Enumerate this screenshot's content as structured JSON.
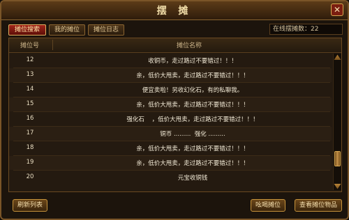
{
  "window": {
    "title": "摆 摊",
    "close_icon": "close-icon"
  },
  "tabs": [
    {
      "label": "摊位搜索",
      "active": true
    },
    {
      "label": "我的摊位",
      "active": false
    },
    {
      "label": "摊位日志",
      "active": false
    }
  ],
  "online": {
    "label": "在线摆摊数：22"
  },
  "table": {
    "headers": {
      "number": "摊位号",
      "name": "摊位名称"
    },
    "rows": [
      {
        "number": "12",
        "name": "收铜币，走过路过不要错过！！！"
      },
      {
        "number": "13",
        "name": "亲，低价大甩卖，走过路过不要错过！！！"
      },
      {
        "number": "14",
        "name": "便宜卖啦！另收幻化石，有的私聊我。"
      },
      {
        "number": "15",
        "name": "亲，低价大甩卖，走过路过不要错过！！！"
      },
      {
        "number": "16",
        "name": "强化石    ，低价大甩卖，走过路过不要错过！！！"
      },
      {
        "number": "17",
        "name": "铜币 .........  强化 ........."
      },
      {
        "number": "18",
        "name": "亲，低价大甩卖，走过路过不要错过！！！"
      },
      {
        "number": "19",
        "name": "亲，低价大甩卖，走过路过不要错过！！！"
      },
      {
        "number": "20",
        "name": "元宝收铜钱"
      }
    ]
  },
  "buttons": {
    "refresh": "刷新列表",
    "shout": "吆喝摊位",
    "view_goods": "查看摊位物品"
  }
}
